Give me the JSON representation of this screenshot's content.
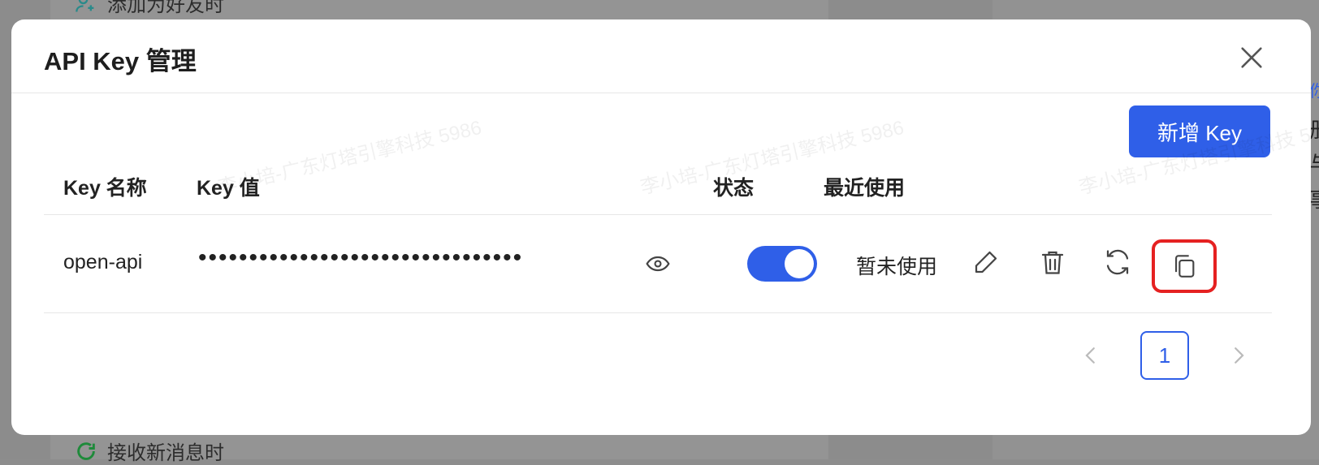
{
  "background": {
    "top_item": "添加为好友时",
    "bottom_item": "接收新消息时",
    "right_edge_chars": [
      "你",
      "册",
      "与",
      "事"
    ]
  },
  "modal": {
    "title": "API Key 管理",
    "add_button": "新增 Key"
  },
  "table": {
    "headers": {
      "name": "Key 名称",
      "value": "Key 值",
      "status": "状态",
      "last_used": "最近使用"
    },
    "rows": [
      {
        "name": "open-api",
        "masked_value": "••••••••••••••••••••••••••••••••",
        "enabled": true,
        "last_used": "暂未使用"
      }
    ]
  },
  "pagination": {
    "current_page": "1"
  },
  "watermark": "李小培-广东灯塔引擎科技 5986",
  "colors": {
    "primary": "#2f5fe8",
    "highlight": "#e52121"
  }
}
